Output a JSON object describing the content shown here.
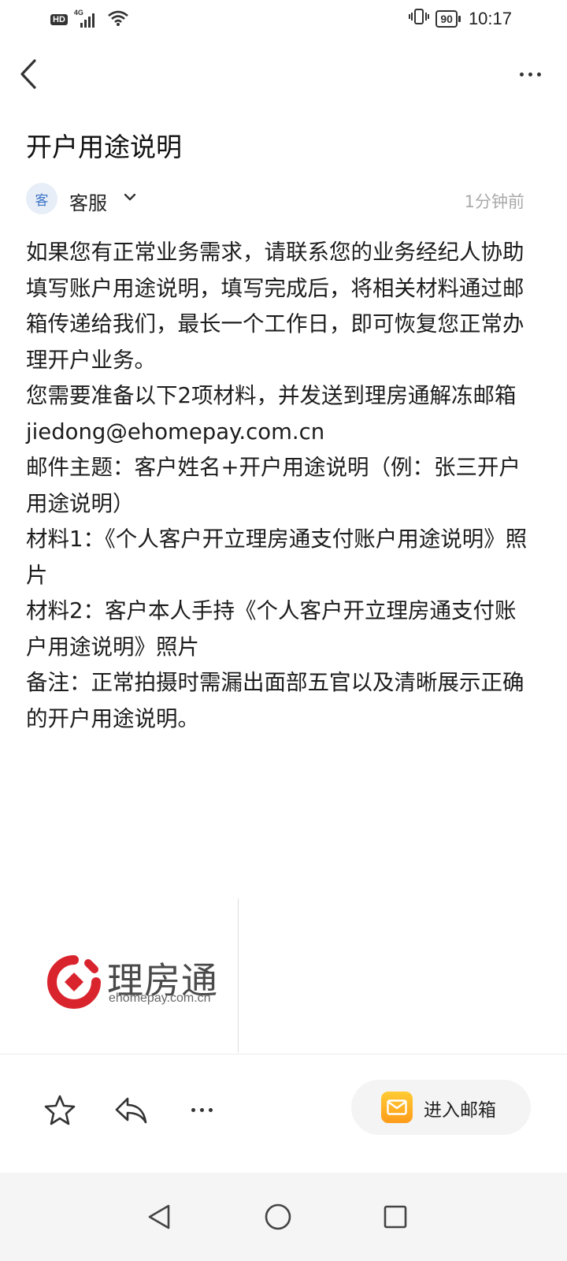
{
  "status_bar": {
    "hd": "HD",
    "network": "4G",
    "battery": "90",
    "time": "10:17"
  },
  "header": {
    "back_icon": "chevron-left-icon",
    "more_icon": "more-horizontal-icon"
  },
  "email": {
    "subject": "开户用途说明",
    "sender": {
      "avatar_text": "客",
      "name": "客服",
      "time": "1分钟前"
    },
    "body": [
      "如果您有正常业务需求，请联系您的业务经纪人协助填写账户用途说明，填写完成后，将相关材料通过邮箱传递给我们，最长一个工作日，即可恢复您正常办理开户业务。",
      "您需要准备以下2项材料，并发送到理房通解冻邮箱jiedong@ehomepay.com.cn",
      "邮件主题：客户姓名+开户用途说明（例：张三开户用途说明）",
      "材料1：《个人客户开立理房通支付账户用途说明》照片",
      "材料2：客户本人手持《个人客户开立理房通支付账户用途说明》照片",
      "备注：正常拍摄时需漏出面部五官以及清晰展示正确的开户用途说明。"
    ],
    "logo": {
      "name": "理房通",
      "domain": "ehomepay.com.cn",
      "brand_color": "#d9232d"
    }
  },
  "actions": {
    "star_icon": "star-icon",
    "reply_icon": "reply-icon",
    "more_icon": "more-horizontal-icon",
    "enter_mailbox_label": "进入邮箱",
    "mail_icon_color": "#ffb020"
  },
  "nav": {
    "back": "nav-back-icon",
    "home": "nav-home-icon",
    "recents": "nav-recents-icon"
  }
}
